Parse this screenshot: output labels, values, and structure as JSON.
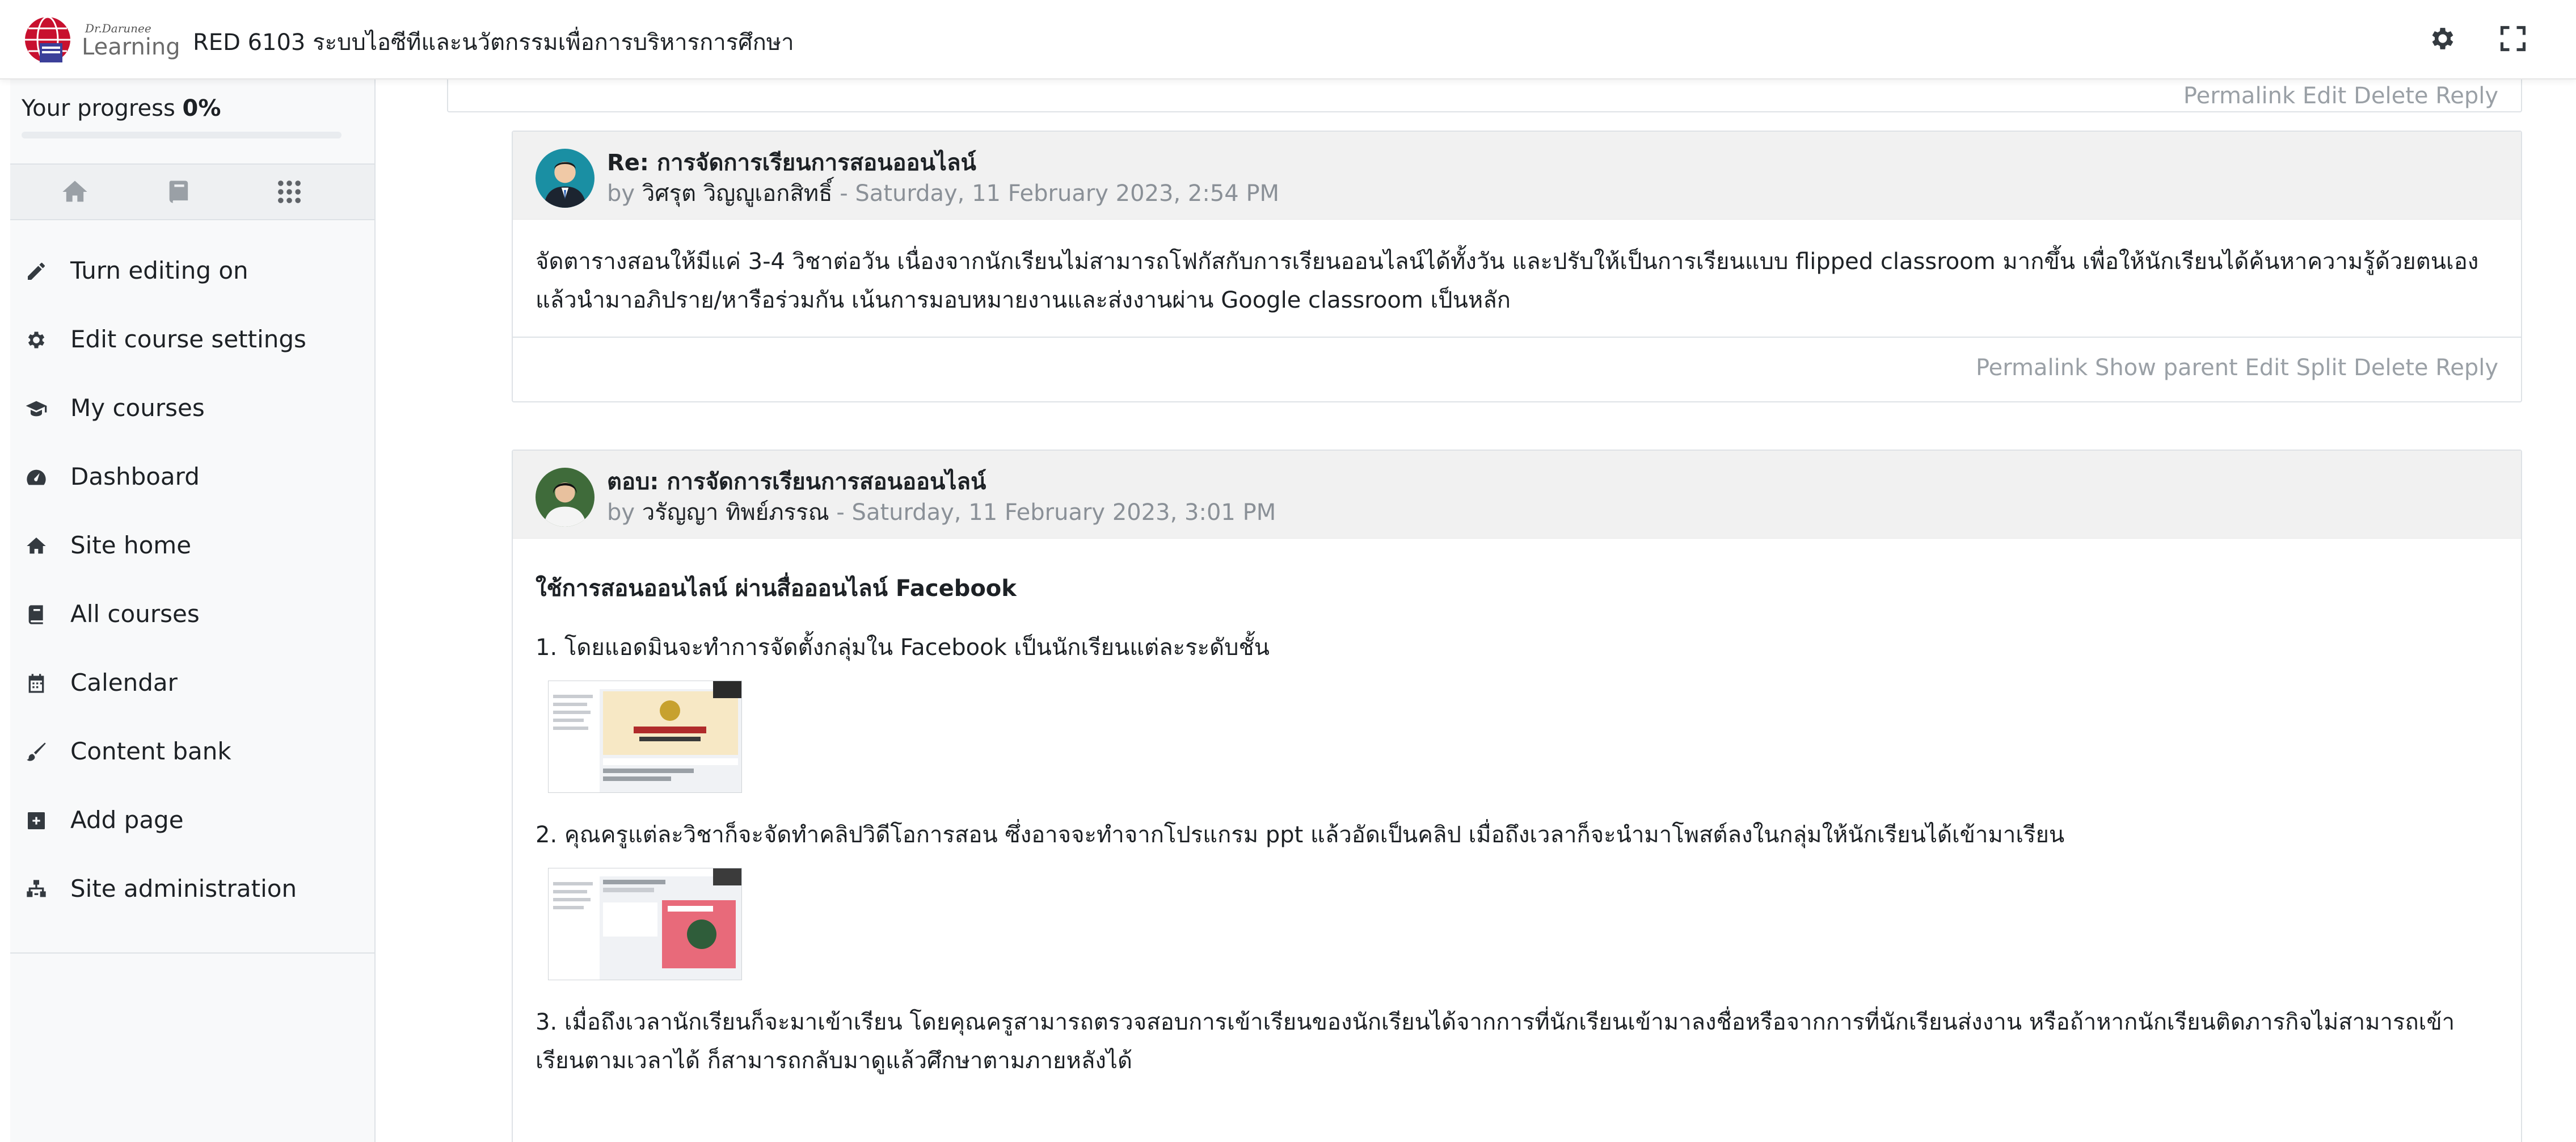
{
  "header": {
    "logo_top": "Dr.Darunee",
    "logo_bottom": "Learning",
    "course_title": "RED 6103 ระบบไอซีทีและนวัตกรรมเพื่อการบริหารการศึกษา"
  },
  "drawer": {
    "progress_label": "Your progress",
    "progress_value": "0%",
    "progress_fraction": 0,
    "menu": [
      {
        "label": "Turn editing on",
        "icon": "pencil-icon"
      },
      {
        "label": "Edit course settings",
        "icon": "gear-icon"
      },
      {
        "label": "My courses",
        "icon": "graduation-cap-icon"
      },
      {
        "label": "Dashboard",
        "icon": "dashboard-icon"
      },
      {
        "label": "Site home",
        "icon": "home-icon"
      },
      {
        "label": "All courses",
        "icon": "book-icon"
      },
      {
        "label": "Calendar",
        "icon": "calendar-icon"
      },
      {
        "label": "Content bank",
        "icon": "paintbrush-icon"
      },
      {
        "label": "Add page",
        "icon": "plus-square-icon"
      },
      {
        "label": "Site administration",
        "icon": "sitemap-icon"
      }
    ]
  },
  "top_commands": "Permalink Edit Delete Reply",
  "posts": [
    {
      "subject": "Re: การจัดการเรียนการสอนออนไลน์",
      "by": "by",
      "author": "วิศรุต วิญญูเอกสิทธิ์",
      "date": "- Saturday, 11 February 2023, 2:54 PM",
      "body": "จัดตารางสอนให้มีแค่ 3-4 วิชาต่อวัน เนื่องจากนักเรียนไม่สามารถโฟกัสกับการเรียนออนไลน์ได้ทั้งวัน และปรับให้เป็นการเรียนแบบ flipped classroom มากขึ้น เพื่อให้นักเรียนได้ค้นหาความรู้ด้วยตนเอง แล้วนำมาอภิปราย/หารือร่วมกัน เน้นการมอบหมายงานและส่งงานผ่าน Google classroom เป็นหลัก",
      "commands": [
        "Permalink",
        "Show parent",
        "Edit",
        "Split",
        "Delete",
        "Reply"
      ]
    },
    {
      "subject": "ตอบ: การจัดการเรียนการสอนออนไลน์",
      "by": "by",
      "author": "วรัญญา ทิพย์ภรรณ",
      "date": "- Saturday, 11 February 2023, 3:01 PM",
      "heading": "ใช้การสอนออนไลน์ ผ่านสื่อออนไลน์ Facebook",
      "item1": " 1. โดยแอดมินจะทำการจัดตั้งกลุ่มใน Facebook เป็นนักเรียนแต่ละระดับชั้น",
      "item2": "2. คุณครูแต่ละวิชาก็จะจัดทำคลิปวิดีโอการสอน  ซึ่งอาจจะทำจากโปรแกรม ppt แล้วอัดเป็นคลิป  เมื่อถึงเวลาก็จะนำมาโพสต์ลงในกลุ่มให้นักเรียนได้เข้ามาเรียน",
      "item3": "3. เมื่อถึงเวลานักเรียนก็จะมาเข้าเรียน โดยคุณครูสามารถตรวจสอบการเข้าเรียนของนักเรียนได้จากการที่นักเรียนเข้ามาลงชื่อหรือจากการที่นักเรียนส่งงาน หรือถ้าหากนักเรียนติดภารกิจไม่สามารถเข้าเรียนตามเวลาได้ ก็สามารถกลับมาดูแล้วศึกษาตามภายหลังได้"
    }
  ]
}
